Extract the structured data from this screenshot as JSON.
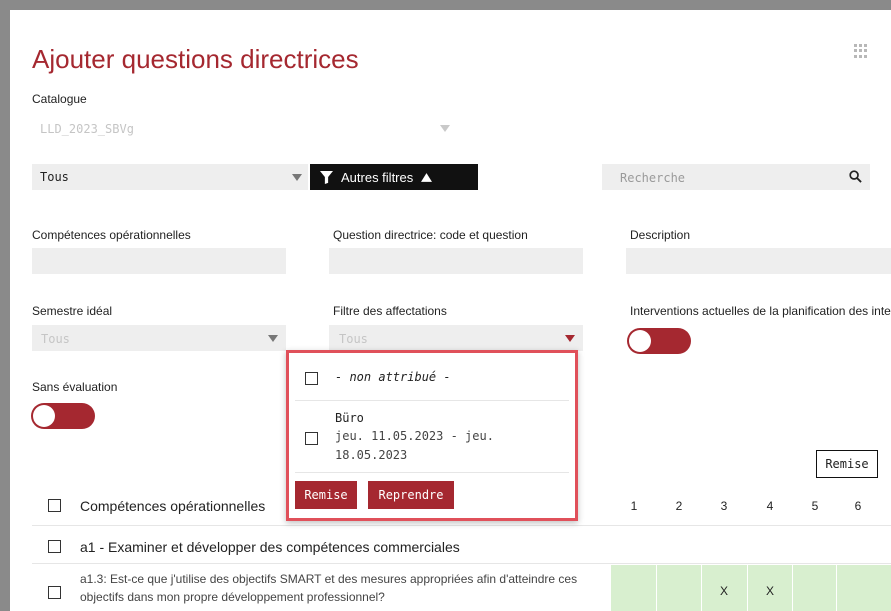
{
  "header": {
    "title": "Ajouter questions directrices",
    "apps_icon": "grid-icon"
  },
  "catalogue": {
    "label": "Catalogue",
    "value": "LLD_2023_SBVg"
  },
  "toolbar": {
    "filter_select": "Tous",
    "more_filters_label": "Autres filtres",
    "search_placeholder": "Recherche"
  },
  "filters": {
    "competences_label": "Compétences opérationnelles",
    "question_label": "Question directrice: code et question",
    "description_label": "Description",
    "semestre_label": "Semestre idéal",
    "semestre_value": "Tous",
    "affectations_label": "Filtre des affectations",
    "affectations_value": "Tous",
    "interventions_label": "Interventions actuelles de la planification des interve",
    "sans_eval_label": "Sans évaluation"
  },
  "dropdown": {
    "option1": "- non attribué -",
    "option2_title": "Büro",
    "option2_line1": "jeu. 11.05.2023 - jeu.",
    "option2_line2": "18.05.2023",
    "reset_label": "Remise",
    "apply_label": "Reprendre"
  },
  "table": {
    "remise_label": "Remise",
    "header_label": "Compétences opérationnelles",
    "columns": [
      "1",
      "2",
      "3",
      "4",
      "5",
      "6"
    ],
    "group_row": "a1 - Examiner et développer des compétences commerciales",
    "item_line1": "a1.3: Est-ce que j'utilise des objectifs SMART et des mesures appropriées afin d'atteindre ces",
    "item_line2": "objectifs dans mon propre développement professionnel?",
    "item_marks": [
      "",
      "",
      "X",
      "X",
      "",
      ""
    ]
  },
  "colors": {
    "accent": "#a52830",
    "highlight": "#e0505a",
    "green": "#d8efcf"
  }
}
